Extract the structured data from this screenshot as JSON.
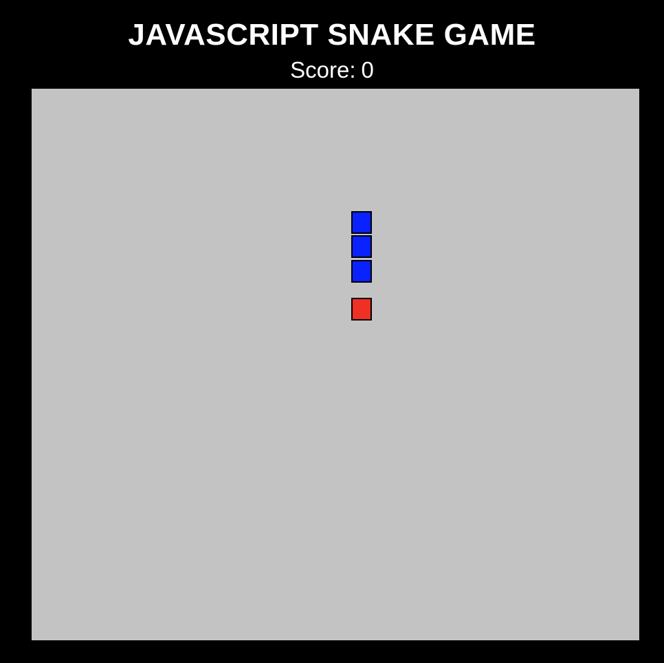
{
  "game": {
    "title": "JAVASCRIPT SNAKE GAME",
    "score_label": "Score:",
    "score_value": "0"
  },
  "board": {
    "background_color": "#c3c3c3"
  },
  "snake": {
    "color": "#0a22ff",
    "segments": [
      {
        "col": 13,
        "row": 5
      },
      {
        "col": 13,
        "row": 6
      },
      {
        "col": 13,
        "row": 7
      }
    ]
  },
  "food": {
    "color": "#ef3024",
    "cell": {
      "col": 13,
      "row": 9
    }
  },
  "colors": {
    "page_background": "#000000",
    "text": "#ffffff",
    "cell_border": "#000000"
  }
}
